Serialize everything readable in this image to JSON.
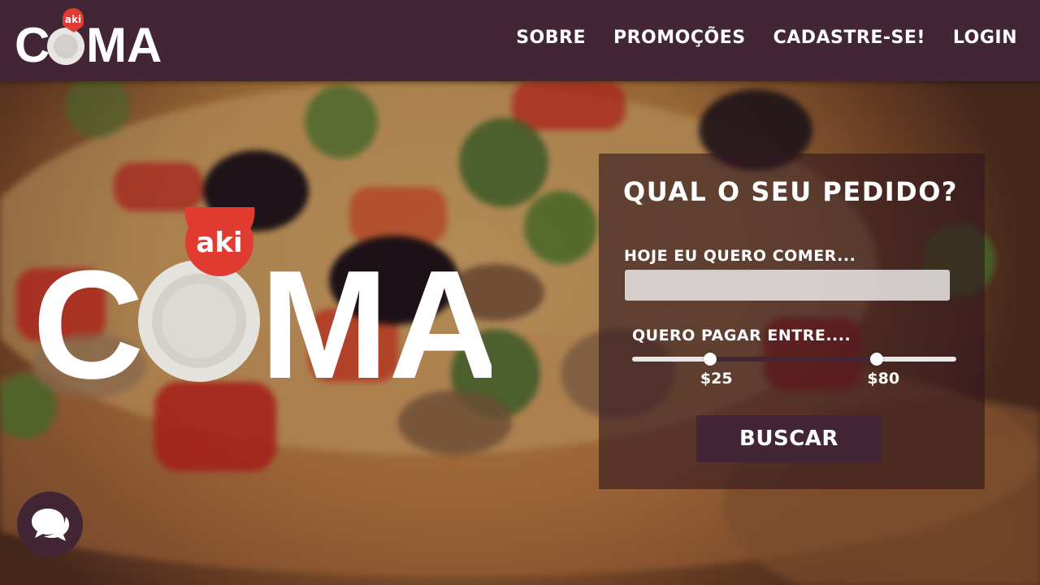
{
  "brand": {
    "badge_text": "aki",
    "name_c": "C",
    "name_rest": "MA",
    "badge_color": "#e03c31"
  },
  "header": {
    "bg_color": "#432636",
    "nav": [
      {
        "label": "SOBRE"
      },
      {
        "label": "PROMOÇÕES"
      },
      {
        "label": "CADASTRE-SE!"
      },
      {
        "label": "LOGIN"
      }
    ]
  },
  "search": {
    "title": "QUAL O SEU PEDIDO?",
    "food_label": "HOJE EU QUERO COMER...",
    "food_value": "",
    "food_placeholder": "",
    "price_label": "QUERO PAGAR ENTRE....",
    "price_min_label": "$25",
    "price_max_label": "$80",
    "price_min_fraction": 0.24,
    "price_max_fraction": 0.755,
    "button_label": "BUSCAR"
  },
  "chat": {
    "icon": "chat-bubbles-icon"
  }
}
